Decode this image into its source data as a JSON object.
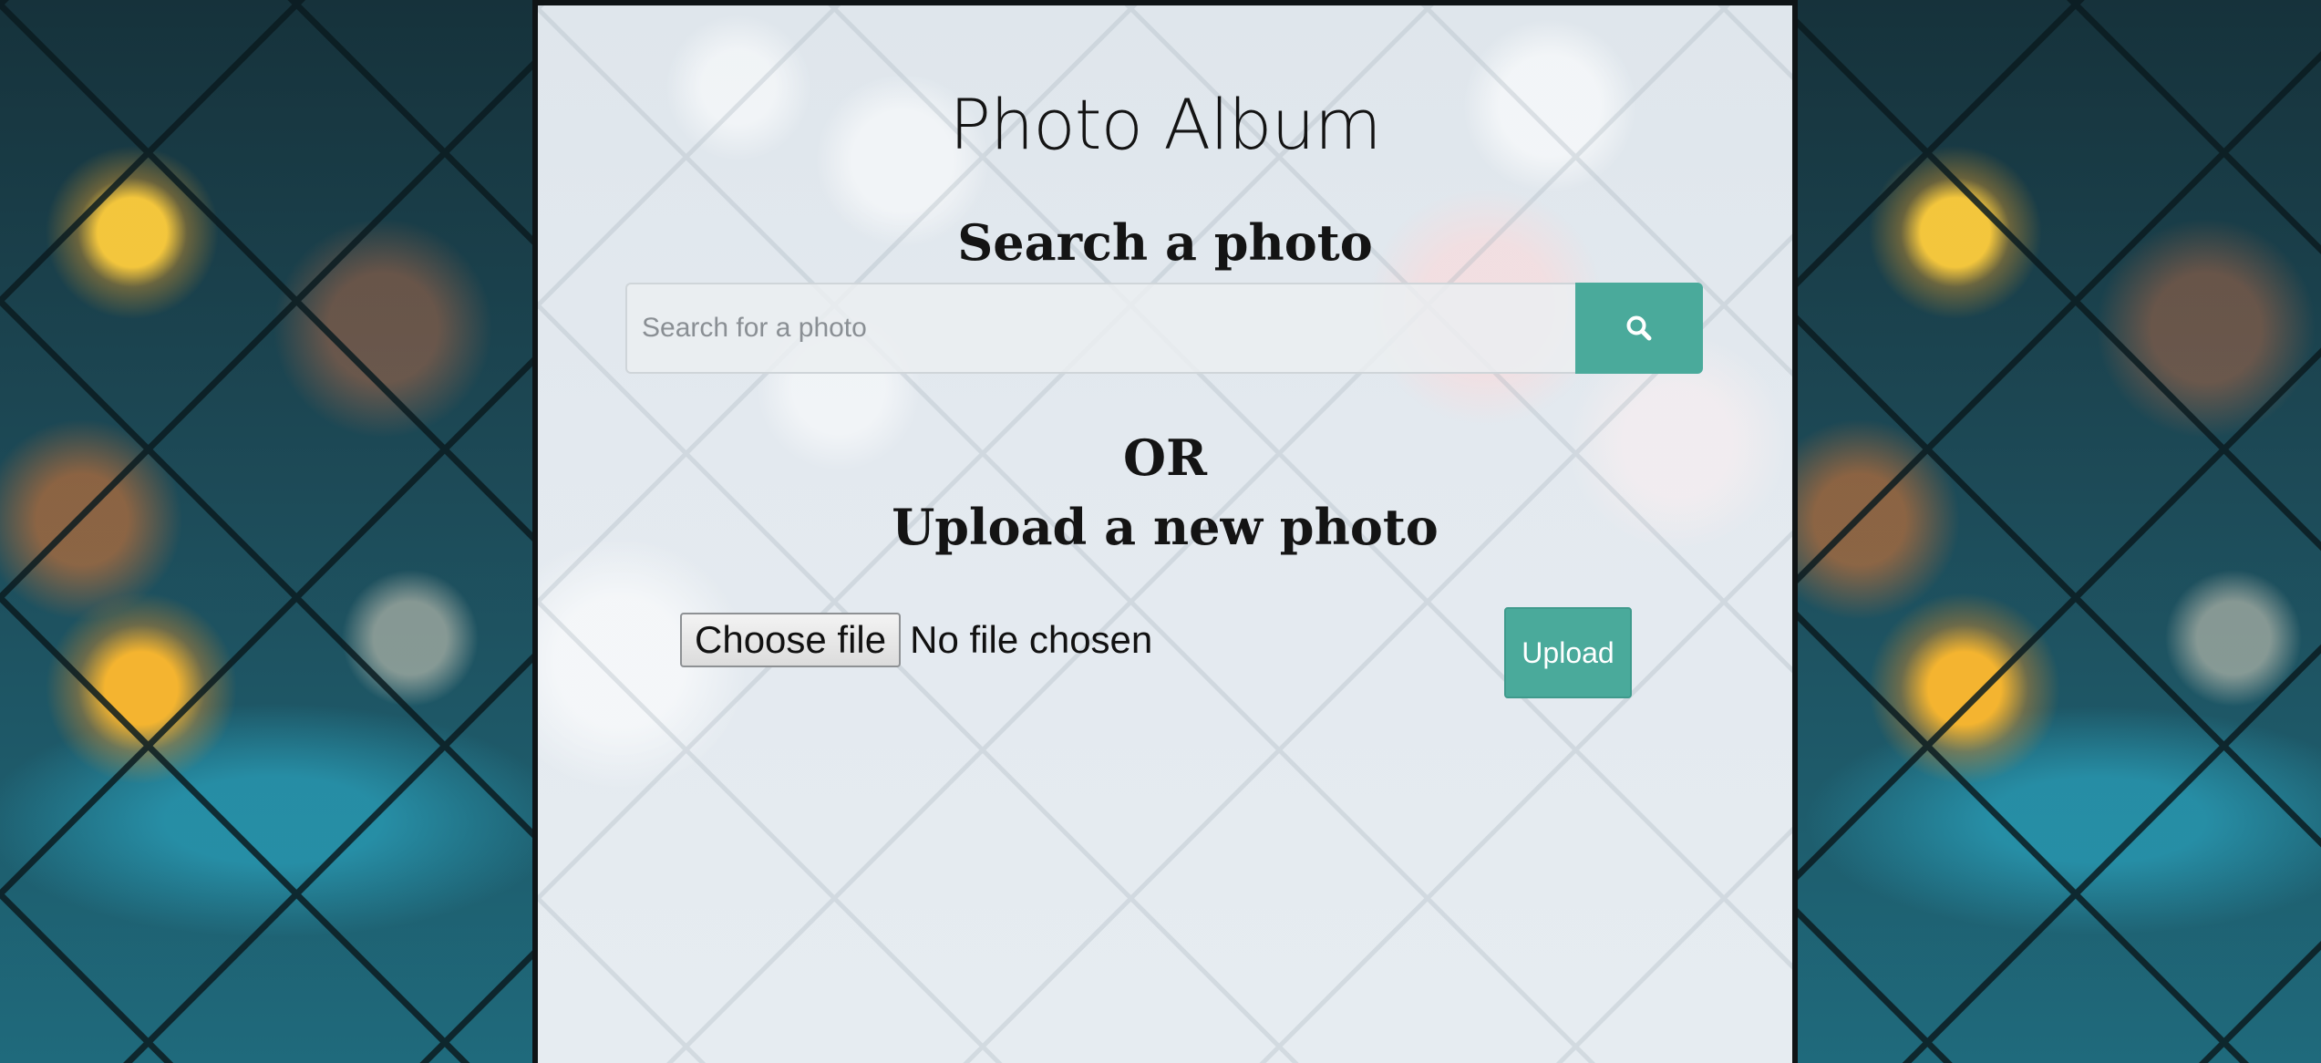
{
  "header": {
    "title": "Photo Album"
  },
  "search": {
    "heading": "Search a photo",
    "placeholder": "Search for a photo",
    "value": "",
    "button_icon": "search-icon"
  },
  "divider": {
    "or_label": "OR"
  },
  "upload": {
    "heading": "Upload a new photo",
    "choose_file_label": "Choose file",
    "no_file_label": "No file chosen",
    "upload_label": "Upload"
  },
  "colors": {
    "accent": "#4aaa9b",
    "panel_background": "#e3e9ef",
    "text": "#141414"
  }
}
